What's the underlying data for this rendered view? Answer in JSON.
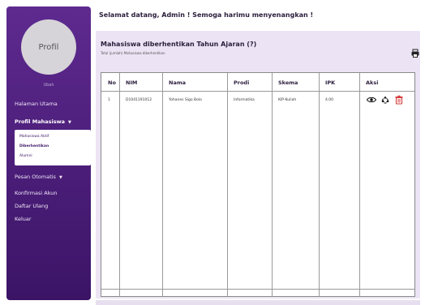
{
  "sidebar": {
    "avatar_label": "Profil",
    "avatar_sub": "Ubah",
    "menu": [
      {
        "label": "Halaman Utama"
      },
      {
        "label": "Profil Mahasiswa",
        "expanded": true
      },
      {
        "label": "Pesan Otomatis",
        "has_dropdown": true
      },
      {
        "label": "Konfirmasi Akun"
      },
      {
        "label": "Daftar Ulang"
      },
      {
        "label": "Keluar"
      }
    ],
    "submenu": [
      {
        "label": "Mahasiswa Aktif"
      },
      {
        "label": "Diberhentikan",
        "active": true
      },
      {
        "label": "Alumni"
      }
    ]
  },
  "header": {
    "welcome": "Selamat datang, Admin ! Semoga harimu menyenangkan !"
  },
  "page": {
    "title": "Mahasiswa diberhentikan Tahun Ajaran (?)",
    "subtitle": "Total (jumlah) Mahasiswa diberhentikan"
  },
  "table": {
    "headers": [
      "No",
      "NIM",
      "Nama",
      "Prodi",
      "Skema",
      "IPK",
      "Aksi"
    ],
    "rows": [
      [
        "1",
        "D1041191012",
        "Yohanes Sigo Bolo",
        "Informatika",
        "KIP-Kuliah",
        "4.00"
      ]
    ]
  },
  "icons": {
    "print": "print-icon",
    "view": "eye-icon",
    "restore": "recycle-icon",
    "delete": "trash-icon"
  },
  "colors": {
    "sidebar_top": "#5e2a8f",
    "sidebar_bottom": "#3b1466",
    "card_bg": "#ece4f4",
    "delete": "#d63b3b",
    "text_dark": "#2b1d3c"
  }
}
